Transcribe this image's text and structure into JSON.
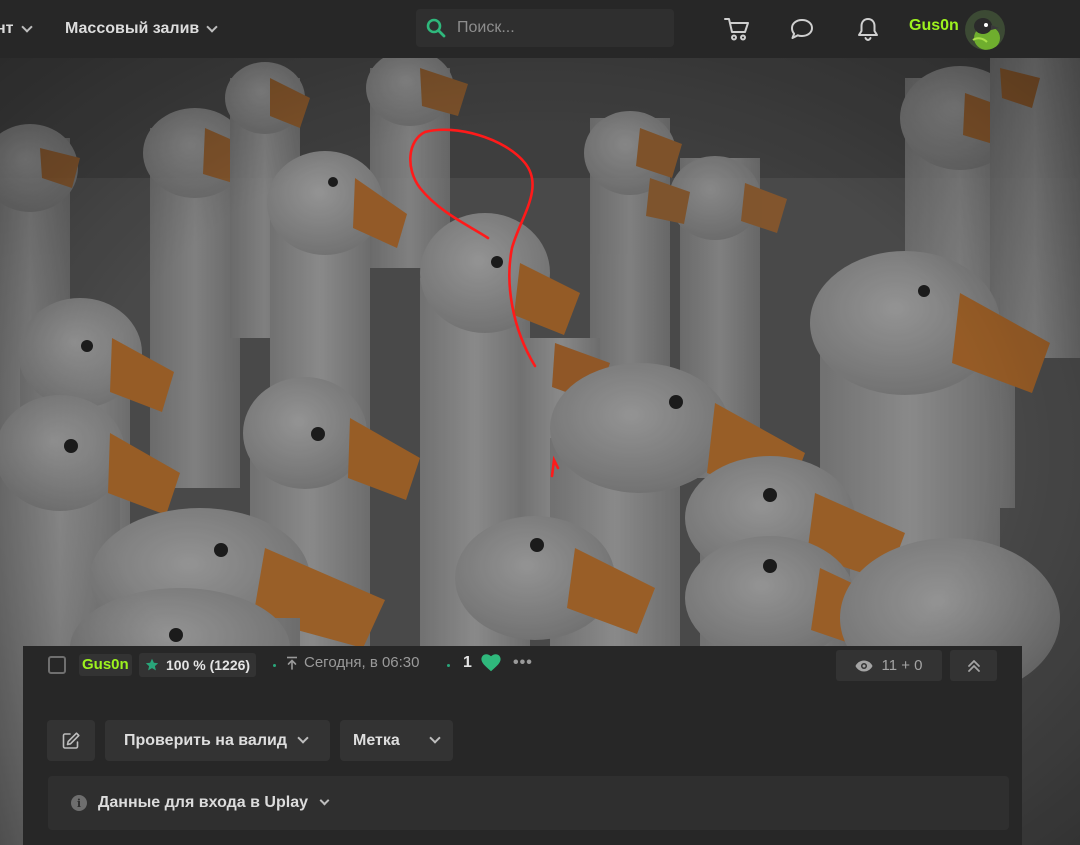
{
  "nav": {
    "item1_label": "нт",
    "item2_label": "Массовый залив"
  },
  "search": {
    "placeholder": "Поиск..."
  },
  "user": {
    "name": "Gus0n"
  },
  "colors": {
    "accent_green": "#9df21e",
    "star_green": "#29a67a",
    "heart_green": "#2fb87c",
    "scribble_red": "#ff1a1a"
  },
  "post": {
    "author": "Gus0n",
    "rating": "100 % (1226)",
    "time": "Сегодня, в 06:30",
    "likes": "1",
    "more": "•••",
    "views": "11 + 0",
    "check_valid_label": "Проверить на валид",
    "mark_label": "Метка",
    "login_data_label": "Данные для входа в Uplay"
  },
  "image": {
    "description_icon": "photo-of-geese-with-red-scribble"
  }
}
